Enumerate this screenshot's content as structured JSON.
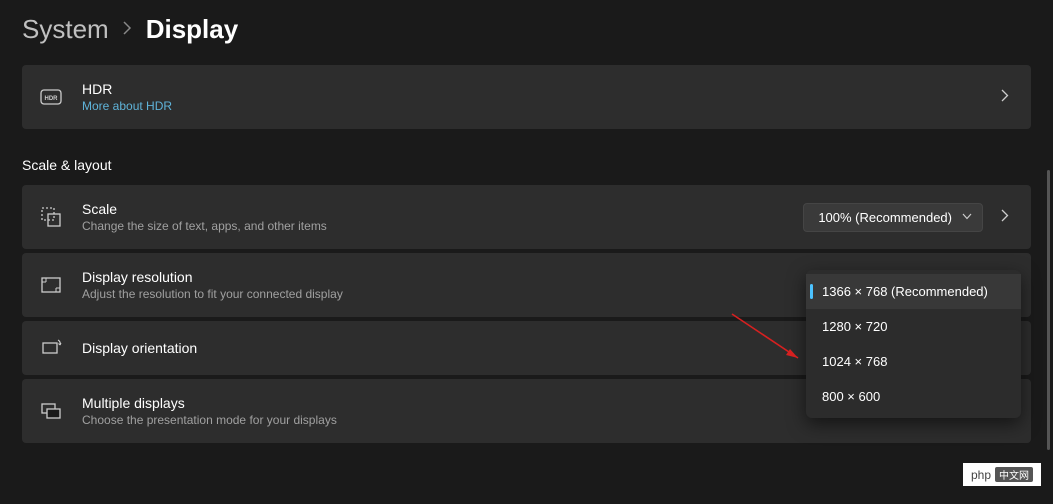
{
  "breadcrumb": {
    "root": "System",
    "current": "Display"
  },
  "hdr": {
    "title": "HDR",
    "link_text": "More about HDR"
  },
  "sections": {
    "scale_layout_heading": "Scale & layout"
  },
  "scale": {
    "title": "Scale",
    "subtitle": "Change the size of text, apps, and other items",
    "value": "100% (Recommended)"
  },
  "resolution": {
    "title": "Display resolution",
    "subtitle": "Adjust the resolution to fit your connected display",
    "options": [
      "1366 × 768 (Recommended)",
      "1280 × 720",
      "1024 × 768",
      "800 × 600"
    ]
  },
  "orientation": {
    "title": "Display orientation"
  },
  "multiple": {
    "title": "Multiple displays",
    "subtitle": "Choose the presentation mode for your displays"
  },
  "watermark": {
    "text": "php",
    "badge": "中文网"
  }
}
